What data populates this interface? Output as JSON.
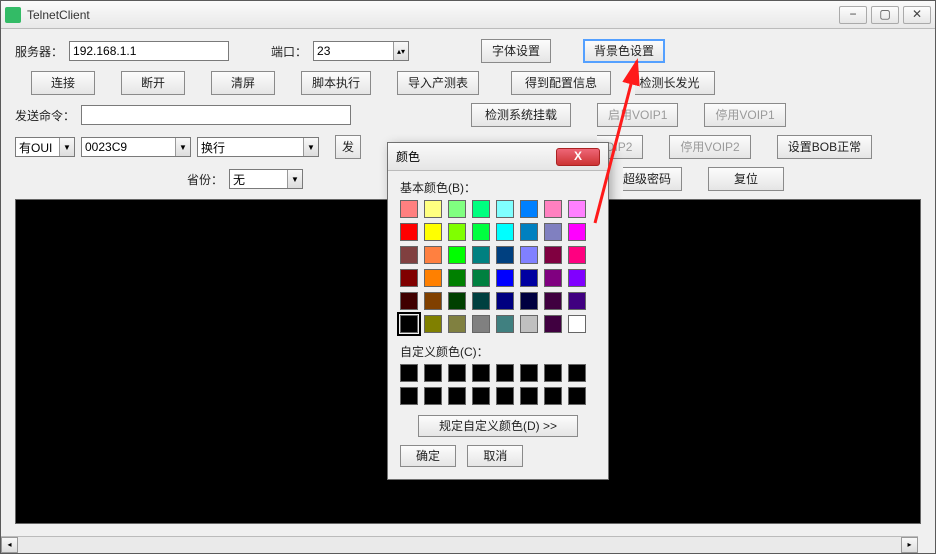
{
  "window": {
    "title": "TelnetClient"
  },
  "labels": {
    "server": "服务器：",
    "port": "端口：",
    "send_cmd": "发送命令：",
    "province": "省份："
  },
  "inputs": {
    "server": "192.168.1.1",
    "port": "23",
    "send_cmd": "",
    "oui_mode": "有OUI",
    "oui_value": "0023C9",
    "linebreak": "换行",
    "province": "无"
  },
  "buttons": {
    "font": "字体设置",
    "bgcolor": "背景色设置",
    "connect": "连接",
    "disconnect": "断开",
    "clear": "清屏",
    "script": "脚本执行",
    "import_list": "导入产测表",
    "get_config": "得到配置信息",
    "detect_long_light": "检测长发光",
    "detect_sys_mount": "检测系统挂载",
    "enable_voip1": "启用VOIP1",
    "disable_voip1": "停用VOIP1",
    "send_partial": "发",
    "enable_voip2_partial": "VOIP2",
    "disable_voip2": "停用VOIP2",
    "set_bob": "设置BOB正常",
    "super_pwd_partial": "超级密码",
    "reset": "复位"
  },
  "color_dialog": {
    "title": "颜色",
    "basic_label": "基本颜色(B)：",
    "custom_label": "自定义颜色(C)：",
    "define_custom": "规定自定义颜色(D) >>",
    "ok": "确定",
    "cancel": "取消",
    "basic_colors": [
      "#ff8080",
      "#ffff80",
      "#80ff80",
      "#00ff80",
      "#80ffff",
      "#0080ff",
      "#ff80c0",
      "#ff80ff",
      "#ff0000",
      "#ffff00",
      "#80ff00",
      "#00ff40",
      "#00ffff",
      "#0080c0",
      "#8080c0",
      "#ff00ff",
      "#804040",
      "#ff8040",
      "#00ff00",
      "#008080",
      "#004080",
      "#8080ff",
      "#800040",
      "#ff0080",
      "#800000",
      "#ff8000",
      "#008000",
      "#008040",
      "#0000ff",
      "#0000a0",
      "#800080",
      "#8000ff",
      "#400000",
      "#804000",
      "#004000",
      "#004040",
      "#000080",
      "#000040",
      "#400040",
      "#400080",
      "#000000",
      "#808000",
      "#808040",
      "#808080",
      "#408080",
      "#c0c0c0",
      "#400040",
      "#ffffff"
    ],
    "selected_index": 40
  }
}
